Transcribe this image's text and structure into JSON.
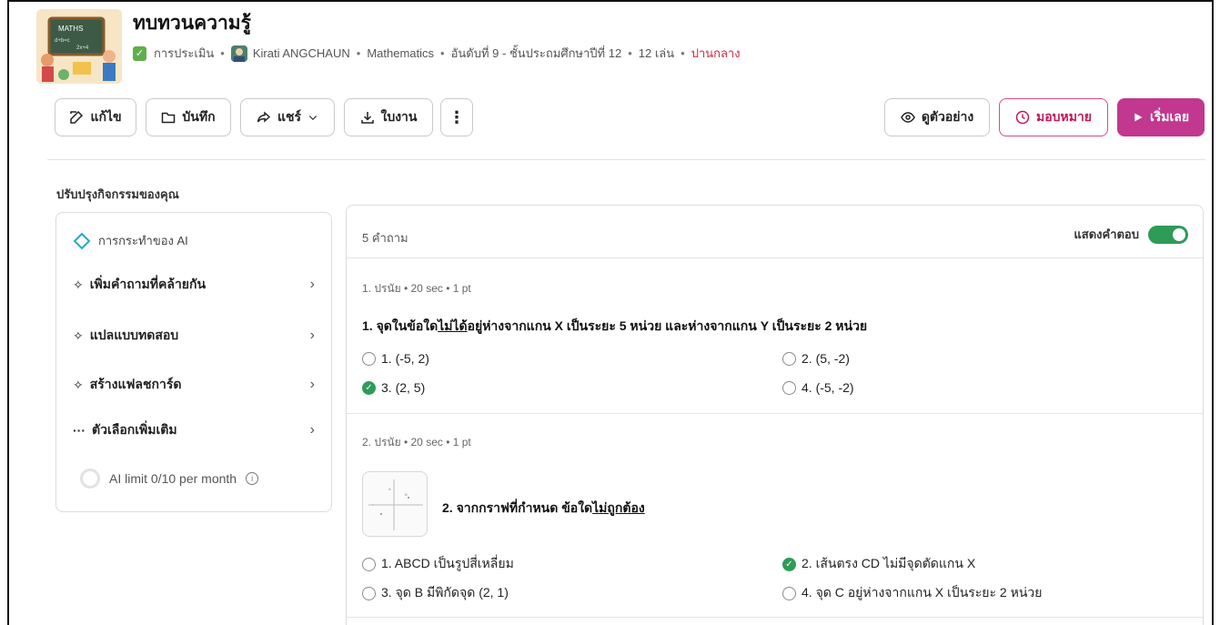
{
  "header": {
    "title": "ทบทวนความรู้",
    "assessment_label": "การประเมิน",
    "author": "Kirati ANGCHAUN",
    "subject": "Mathematics",
    "grade": "อันดับที่ 9 - ชั้นประถมศึกษาปีที่ 12",
    "plays": "12 เล่น",
    "level": "ปานกลาง",
    "thumb_text": "MATHS"
  },
  "toolbar": {
    "edit": "แก้ไข",
    "save": "บันทึก",
    "share": "แชร์",
    "worksheet": "ใบงาน",
    "more": "⋮",
    "preview": "ดูตัวอย่าง",
    "assign": "มอบหมาย",
    "start": "เริ่มเลย"
  },
  "section_title": "ปรับปรุงกิจกรรมของคุณ",
  "ai_panel": {
    "heading": "การกระทำของ AI",
    "items": [
      {
        "label": "เพิ่มคำถามที่คล้ายกัน",
        "icon": "sparkle-icon"
      },
      {
        "label": "แปลแบบทดสอบ",
        "icon": "sparkle-icon"
      },
      {
        "label": "สร้างแฟลชการ์ด",
        "icon": "sparkle-icon"
      },
      {
        "label": "ตัวเลือกเพิ่มเติม",
        "icon": "ellipsis-icon"
      }
    ],
    "limit": "AI limit 0/10 per month"
  },
  "questions_panel": {
    "count": "5 คำถาม",
    "show_answers_label": "แสดงคำตอบ",
    "show_answers": true,
    "questions": [
      {
        "meta": "1. ปรนัย  •  20 sec  •  1 pt",
        "text_before": "1. จุดในข้อใด",
        "text_underline": "ไม่ได้",
        "text_after": "อยู่ห่างจากแกน X เป็นระยะ 5 หน่วย และห่างจากแกน Y เป็นระยะ 2 หน่วย",
        "options": [
          "1. (-5, 2)",
          "2. (5, -2)",
          "3. (2, 5)",
          "4. (-5, -2)"
        ],
        "correct_index": 2
      },
      {
        "meta": "2. ปรนัย  •  20 sec  •  1 pt",
        "text_before": "2. จากกราฟที่กำหนด ข้อใด",
        "text_underline": "ไม่ถูกต้อง",
        "text_after": "",
        "options": [
          "1. ABCD เป็นรูปสี่เหลี่ยม",
          "2. เส้นตรง CD ไม่มีจุดตัดแกน X",
          "3. จุด B มีพิกัดจุด (2, 1)",
          "4. จุด C อยู่ห่างจากแกน X เป็นระยะ 2 หน่วย"
        ],
        "correct_index": 1
      }
    ]
  },
  "colors": {
    "accent": "#c2378f",
    "correct": "#2e9b57",
    "level": "#d7263d"
  }
}
